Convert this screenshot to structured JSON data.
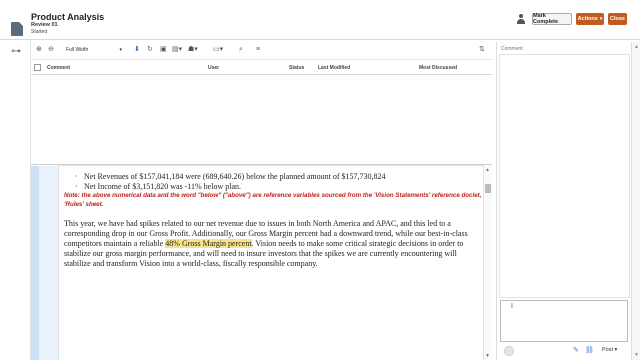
{
  "header": {
    "title": "Product Analysis",
    "subtitle": "Review 01",
    "status": "Started",
    "mark_complete_label": "Mark Complete",
    "actions_label": "Actions",
    "close_label": "Close"
  },
  "toolbar": {
    "zoom_value": "Full Width"
  },
  "grid": {
    "columns": [
      "Comment",
      "User",
      "Status",
      "Last Modified",
      "Most Discussed"
    ]
  },
  "document": {
    "bullets": [
      "Net Revenues of $157,041,184 were (689,640.26) below the planned amount of $157,730,824",
      "Net Income of $3,151,820 was -11% below plan."
    ],
    "note": "Note: the above numerical data and the word \"below\" (\"above\") are reference variables sourced from the 'Vision Statements' reference doclet, 'Rules' sheet.",
    "para_before": "This year, we have had spikes related to our net revenue due to issues in both North America and APAC, and this led to a corresponding drop in our Gross Profit.   Additionally, our Gross Margin percent had a downward trend, while our best-in-class competitors maintain a reliable ",
    "para_highlight": "48% Gross Margin percent",
    "para_after": ".   Vision needs to make some critical strategic decisions in order to stabilize our gross margin performance, and will need to insure investors that the spikes we are currently encountering will stabilize and transform Vision into a world-class, fiscally responsible company."
  },
  "comment_panel": {
    "label": "Comment",
    "post_label": "Post"
  },
  "colors": {
    "accent": "#c25b1d",
    "note_red": "#c0201a",
    "highlight": "#f7e48a"
  }
}
